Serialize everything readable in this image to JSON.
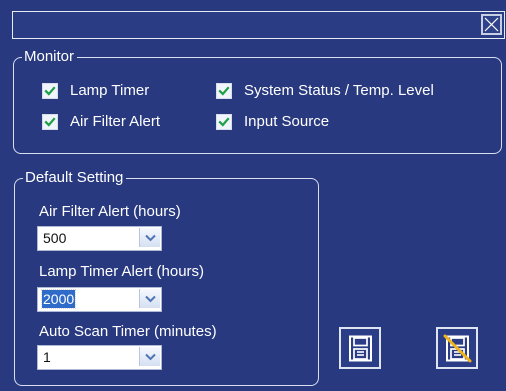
{
  "window": {
    "close_icon": "close-icon"
  },
  "monitor": {
    "title": "Monitor",
    "items": [
      {
        "label": "Lamp Timer",
        "checked": true
      },
      {
        "label": "Air Filter Alert",
        "checked": true
      },
      {
        "label": "System Status / Temp. Level",
        "checked": true
      },
      {
        "label": "Input Source",
        "checked": true
      }
    ]
  },
  "default_setting": {
    "title": "Default Setting",
    "air_filter_label": "Air Filter Alert (hours)",
    "air_filter_value": "500",
    "lamp_timer_label": "Lamp Timer Alert (hours)",
    "lamp_timer_value": "2000",
    "auto_scan_label": "Auto Scan Timer (minutes)",
    "auto_scan_value": "1"
  },
  "actions": {
    "save_icon": "save-icon",
    "cancel_save_icon": "cancel-save-icon"
  },
  "colors": {
    "background": "#28397f",
    "line": "#d9dfee",
    "accent": "#2f6bc9",
    "check": "#1f9f45"
  }
}
